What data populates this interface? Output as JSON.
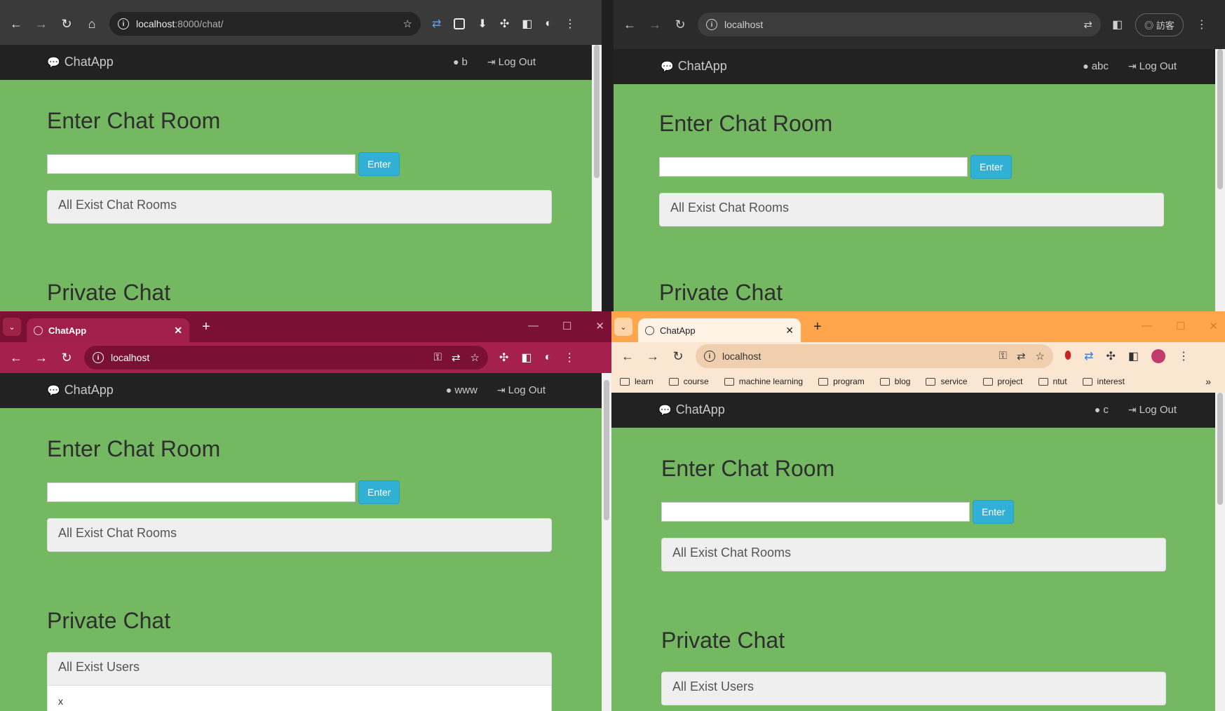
{
  "app": {
    "brand": "ChatApp",
    "logout": "Log Out",
    "enter_room_title": "Enter Chat Room",
    "enter_button": "Enter",
    "rooms_panel": "All Exist Chat Rooms",
    "private_title": "Private Chat",
    "users_panel": "All Exist Users"
  },
  "tab_title": "ChatApp",
  "url_host": "localhost",
  "url_path": ":8000/chat/",
  "guest_label": "訪客",
  "windows": {
    "w1": {
      "user": "b"
    },
    "w2": {
      "user": "abc"
    },
    "w3": {
      "user": "www",
      "users_list": [
        "x"
      ]
    },
    "w4": {
      "user": "c"
    }
  },
  "bookmarks": [
    "learn",
    "course",
    "machine learning",
    "program",
    "blog",
    "service",
    "project",
    "ntut",
    "interest"
  ],
  "colors": {
    "page_green": "#74b862",
    "navbar": "#222222",
    "enter_button": "#31b0d5",
    "w3_frame": "#7a1134",
    "w4_frame": "#ffa64d"
  },
  "icons": [
    "back-icon",
    "forward-icon",
    "reload-icon",
    "home-icon",
    "info-icon",
    "star-icon",
    "translate-icon",
    "extension-icon",
    "sidepanel-icon",
    "menu-icon",
    "key-icon",
    "comments-icon",
    "user-icon",
    "logout-icon",
    "folder-icon"
  ]
}
